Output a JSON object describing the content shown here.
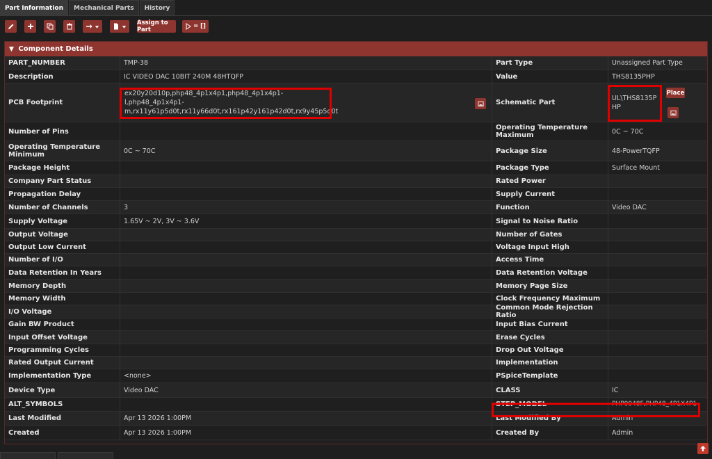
{
  "tabs": [
    "Part Information",
    "Mechanical Parts",
    "History"
  ],
  "toolbar": {
    "assign_label": "Assign to Part",
    "run_label": "= []"
  },
  "panel": {
    "title": "Component Details"
  },
  "icons": {
    "edit": "pencil-icon",
    "add": "plus-icon",
    "copy": "copy-icon",
    "delete": "trash-icon",
    "arrow": "arrow-right-icon",
    "file": "file-icon",
    "image": "image-icon",
    "scroll": "arrow-up-icon"
  },
  "rows": [
    {
      "l1": "PART_NUMBER",
      "v1": "TMP-38",
      "l2": "Part Type",
      "v2": "Unassigned Part Type"
    },
    {
      "l1": "Description",
      "v1": "IC VIDEO DAC 10BIT 240M 48HTQFP",
      "l2": "Value",
      "v2": "THS8135PHP"
    },
    {
      "l1": "PCB Footprint",
      "v1": "ex20y20d10p,php48_4p1x4p1,php48_4p1x4p1-l,php48_4p1x4p1-m,rx11y61p5d0t,rx11y66d0t,rx161p42y161p42d0t,rx9y45p5d0t",
      "l2": "Schematic Part",
      "v2": "UL\\THS8135PHP"
    },
    {
      "l1": "Number of Pins",
      "v1": "",
      "l2": "Operating Temperature Maximum",
      "v2": "0C ~ 70C"
    },
    {
      "l1": "Operating Temperature Minimum",
      "v1": "0C ~ 70C",
      "l2": "Package Size",
      "v2": "48-PowerTQFP"
    },
    {
      "l1": "Package Height",
      "v1": "",
      "l2": "Package Type",
      "v2": "Surface Mount"
    },
    {
      "l1": "Company Part Status",
      "v1": "",
      "l2": "Rated Power",
      "v2": ""
    },
    {
      "l1": "Propagation Delay",
      "v1": "",
      "l2": "Supply Current",
      "v2": ""
    },
    {
      "l1": "Number of Channels",
      "v1": "3",
      "l2": "Function",
      "v2": "Video DAC"
    },
    {
      "l1": "Supply Voltage",
      "v1": "1.65V ~ 2V, 3V ~ 3.6V",
      "l2": "Signal to Noise Ratio",
      "v2": ""
    },
    {
      "l1": "Output Voltage",
      "v1": "",
      "l2": "Number of Gates",
      "v2": ""
    },
    {
      "l1": "Output Low Current",
      "v1": "",
      "l2": "Voltage Input High",
      "v2": ""
    },
    {
      "l1": "Number of I/O",
      "v1": "",
      "l2": "Access Time",
      "v2": ""
    },
    {
      "l1": "Data Retention In Years",
      "v1": "",
      "l2": "Data Retention Voltage",
      "v2": ""
    },
    {
      "l1": "Memory Depth",
      "v1": "",
      "l2": "Memory Page Size",
      "v2": ""
    },
    {
      "l1": "Memory Width",
      "v1": "",
      "l2": "Clock Frequency Maximum",
      "v2": ""
    },
    {
      "l1": "I/O Voltage",
      "v1": "",
      "l2": "Common Mode Rejection Ratio",
      "v2": ""
    },
    {
      "l1": "Gain BW Product",
      "v1": "",
      "l2": "Input Bias Current",
      "v2": ""
    },
    {
      "l1": "Input Offset Voltage",
      "v1": "",
      "l2": "Erase Cycles",
      "v2": ""
    },
    {
      "l1": "Programming Cycles",
      "v1": "",
      "l2": "Drop Out Voltage",
      "v2": ""
    },
    {
      "l1": "Rated Output Current",
      "v1": "",
      "l2": "Implementation",
      "v2": ""
    },
    {
      "l1": "Implementation Type",
      "v1": "<none>",
      "l2": "PSpiceTemplate",
      "v2": ""
    },
    {
      "l1": "Device Type",
      "v1": "Video DAC",
      "l2": "CLASS",
      "v2": "IC"
    },
    {
      "l1": "ALT_SYMBOLS",
      "v1": "",
      "l2": "STEP_MODEL",
      "v2": "PHP0048F,PHP48_4P1X4P1"
    },
    {
      "l1": "Last Modified",
      "v1": "Apr 13 2026 1:00PM",
      "l2": "Last Modified By",
      "v2": "Admin"
    },
    {
      "l1": "Created",
      "v1": "Apr 13 2026 1:00PM",
      "l2": "Created By",
      "v2": "Admin"
    }
  ],
  "schematic_place_label": "Place",
  "colors": {
    "accent": "#8f3530",
    "highlight": "#e00000",
    "background": "#1e1e1e"
  }
}
